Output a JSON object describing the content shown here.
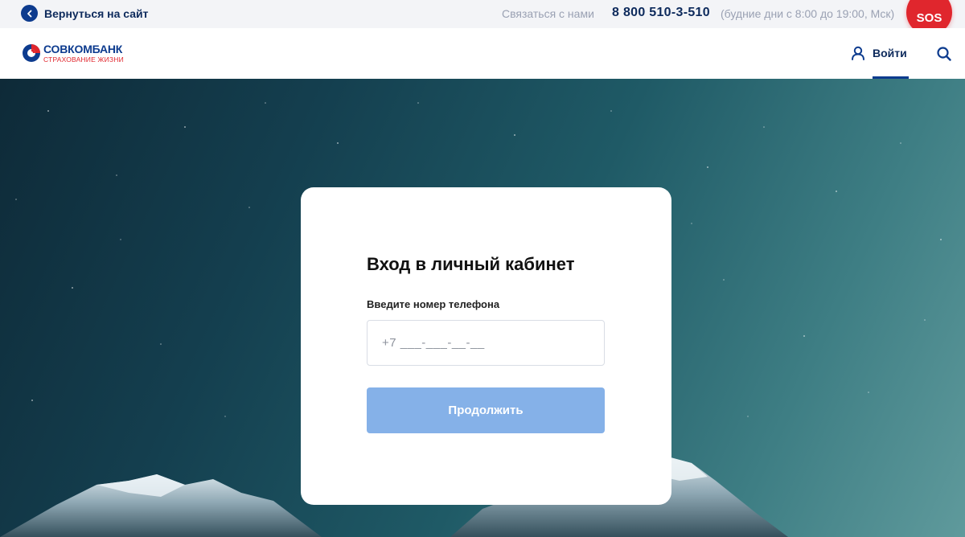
{
  "topbar": {
    "back_label": "Вернуться на сайт",
    "contact_label": "Связаться с нами",
    "phone": "8 800 510-3-510",
    "hours": "(будние дни с 8:00 до 19:00, Мск)",
    "sos_label": "SOS"
  },
  "header": {
    "logo_main": "СОВКОМБАНК",
    "logo_sub": "СТРАХОВАНИЕ ЖИЗНИ",
    "login_label": "Войти"
  },
  "login_form": {
    "title": "Вход в личный кабинет",
    "phone_label": "Введите номер телефона",
    "phone_placeholder": "+7 ___-___-__-__",
    "phone_value": "",
    "continue_label": "Продолжить"
  },
  "colors": {
    "brand_blue": "#0d3b8e",
    "brand_red": "#e0262d",
    "button_disabled": "#85b1e8"
  },
  "icons": [
    "chevron-left-icon",
    "user-icon",
    "search-icon",
    "logo-icon"
  ]
}
